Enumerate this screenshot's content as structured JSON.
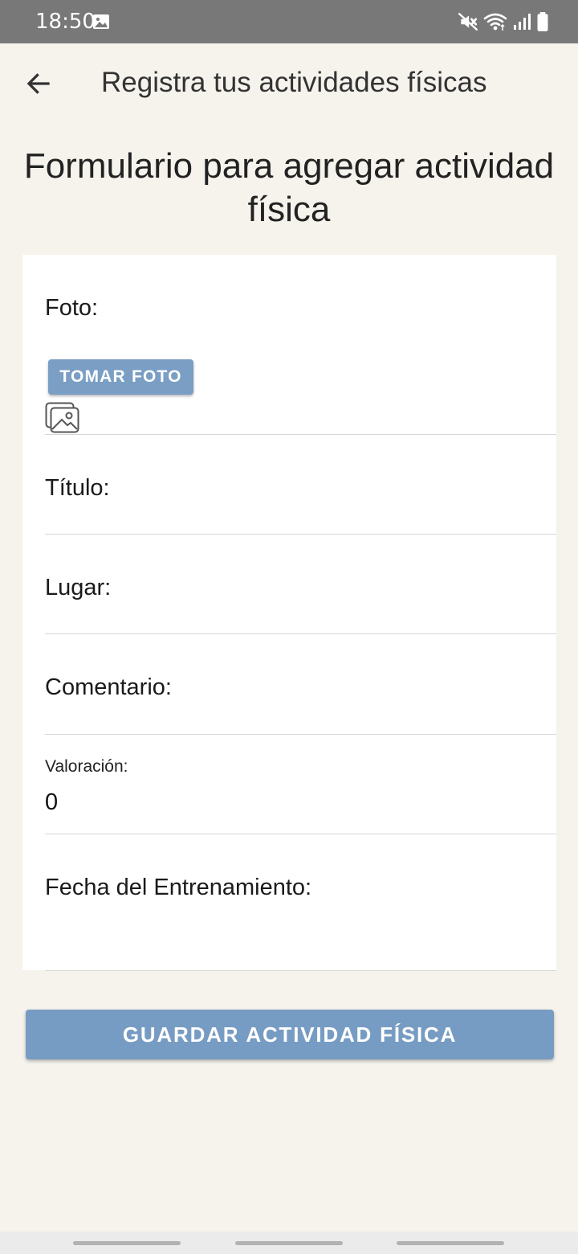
{
  "status_bar": {
    "time": "18:50",
    "left_icons": [
      "image-icon"
    ],
    "right_icons": [
      "mute-icon",
      "wifi-icon",
      "signal-icon",
      "battery-icon"
    ]
  },
  "app_bar": {
    "back_icon": "arrow-left-icon",
    "title": "Registra tus actividades físicas"
  },
  "form": {
    "heading": "Formulario para agregar actividad física",
    "foto": {
      "label": "Foto:",
      "button_label": "TOMAR FOTO",
      "placeholder_icon": "image-placeholder-icon"
    },
    "titulo": {
      "label": "Título:",
      "value": ""
    },
    "lugar": {
      "label": "Lugar:",
      "value": ""
    },
    "comentario": {
      "label": "Comentario:",
      "value": ""
    },
    "valoracion": {
      "label": "Valoración:",
      "value": "0"
    },
    "fecha": {
      "label": "Fecha del Entrenamiento:",
      "value": ""
    }
  },
  "save_button": {
    "label": "GUARDAR ACTIVIDAD FÍSICA"
  },
  "colors": {
    "background": "#f5f3ec",
    "status_bar": "#787878",
    "accent_button": "#779cc3",
    "card": "#ffffff"
  }
}
